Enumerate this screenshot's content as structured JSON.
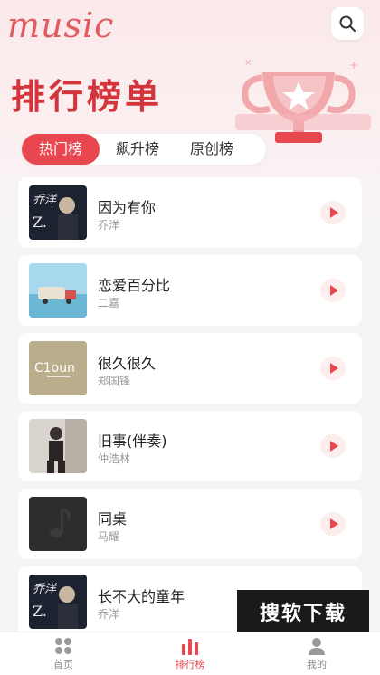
{
  "header": {
    "logo": "music",
    "search_icon": "search-icon",
    "title": "排行榜单"
  },
  "tabs": [
    {
      "label": "热门榜",
      "active": true
    },
    {
      "label": "飙升榜",
      "active": false
    },
    {
      "label": "原创榜",
      "active": false
    }
  ],
  "songs": [
    {
      "title": "因为有你",
      "artist": "乔洋"
    },
    {
      "title": "恋爱百分比",
      "artist": "二嘉"
    },
    {
      "title": "很久很久",
      "artist": "郑国锋"
    },
    {
      "title": "旧事(伴奏)",
      "artist": "仲浩林"
    },
    {
      "title": "同桌",
      "artist": "马耀"
    },
    {
      "title": "长不大的童年",
      "artist": "乔洋"
    }
  ],
  "watermark": "搜软下载",
  "nav": {
    "items": [
      {
        "label": "首页",
        "icon": "grid-icon",
        "active": false
      },
      {
        "label": "排行榜",
        "icon": "bar-chart-icon",
        "active": true
      },
      {
        "label": "我的",
        "icon": "user-icon",
        "active": false
      }
    ]
  },
  "colors": {
    "accent": "#e9474f",
    "title_red": "#d4343c",
    "logo": "#e25b63"
  }
}
